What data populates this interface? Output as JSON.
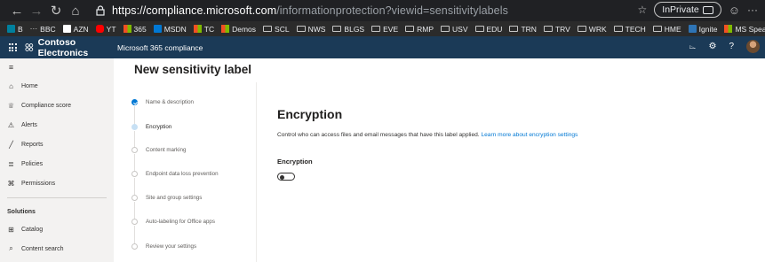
{
  "browser": {
    "url_host": "https://compliance.microsoft.com",
    "url_path": "/informationprotection?viewid=sensitivitylabels",
    "inprivate_label": "InPrivate"
  },
  "favorites": [
    {
      "label": "B",
      "icon": "bing-icon",
      "color": "#00809d"
    },
    {
      "label": "BBC",
      "icon": "dots-icon",
      "color": "#c7c7c7"
    },
    {
      "label": "AZN",
      "icon": "amazon-icon",
      "color": "#ffffff"
    },
    {
      "label": "YT",
      "icon": "youtube-icon",
      "color": "#ff0000"
    },
    {
      "label": "365",
      "icon": "microsoft-icon",
      "color": "#f25022"
    },
    {
      "label": "MSDN",
      "icon": "azure-icon",
      "color": "#0078d4"
    },
    {
      "label": "TC",
      "icon": "microsoft-icon",
      "color": "#f25022"
    },
    {
      "label": "Demos",
      "icon": "microsoft-icon",
      "color": "#f25022"
    },
    {
      "label": "SCL",
      "icon": "folder-icon"
    },
    {
      "label": "NWS",
      "icon": "folder-icon"
    },
    {
      "label": "BLGS",
      "icon": "folder-icon"
    },
    {
      "label": "EVE",
      "icon": "folder-icon"
    },
    {
      "label": "RMP",
      "icon": "folder-icon"
    },
    {
      "label": "USV",
      "icon": "folder-icon"
    },
    {
      "label": "EDU",
      "icon": "folder-icon"
    },
    {
      "label": "TRN",
      "icon": "folder-icon"
    },
    {
      "label": "TRV",
      "icon": "folder-icon"
    },
    {
      "label": "WRK",
      "icon": "folder-icon"
    },
    {
      "label": "TECH",
      "icon": "folder-icon"
    },
    {
      "label": "HME",
      "icon": "folder-icon"
    },
    {
      "label": "Ignite",
      "icon": "ignite-icon",
      "color": "#2e74b5"
    },
    {
      "label": "MS Speaker",
      "icon": "microsoft-icon",
      "color": "#f25022"
    }
  ],
  "header": {
    "org_name": "Contoso Electronics",
    "app_name": "Microsoft 365 compliance",
    "bar_color": "#1b3a57"
  },
  "nav": {
    "items": [
      {
        "label": "Home",
        "icon": "home-icon"
      },
      {
        "label": "Compliance score",
        "icon": "trophy-icon"
      },
      {
        "label": "Alerts",
        "icon": "warning-icon"
      },
      {
        "label": "Reports",
        "icon": "chart-icon"
      },
      {
        "label": "Policies",
        "icon": "sliders-icon"
      },
      {
        "label": "Permissions",
        "icon": "key-icon"
      }
    ],
    "section_label": "Solutions",
    "solutions": [
      {
        "label": "Catalog",
        "icon": "grid-icon"
      },
      {
        "label": "Content search",
        "icon": "search-icon"
      }
    ]
  },
  "page": {
    "title": "New sensitivity label"
  },
  "wizard": {
    "steps": [
      {
        "label": "Name & description",
        "state": "done"
      },
      {
        "label": "Encryption",
        "state": "current"
      },
      {
        "label": "Content marking",
        "state": "pending"
      },
      {
        "label": "Endpoint data loss prevention",
        "state": "pending"
      },
      {
        "label": "Site and group settings",
        "state": "pending"
      },
      {
        "label": "Auto-labeling for Office apps",
        "state": "pending"
      },
      {
        "label": "Review your settings",
        "state": "pending"
      }
    ]
  },
  "content": {
    "title": "Encryption",
    "description": "Control who can access files and email messages that have this label applied.",
    "link_text": "Learn more about encryption settings",
    "field_label": "Encryption",
    "toggle_on": false
  }
}
